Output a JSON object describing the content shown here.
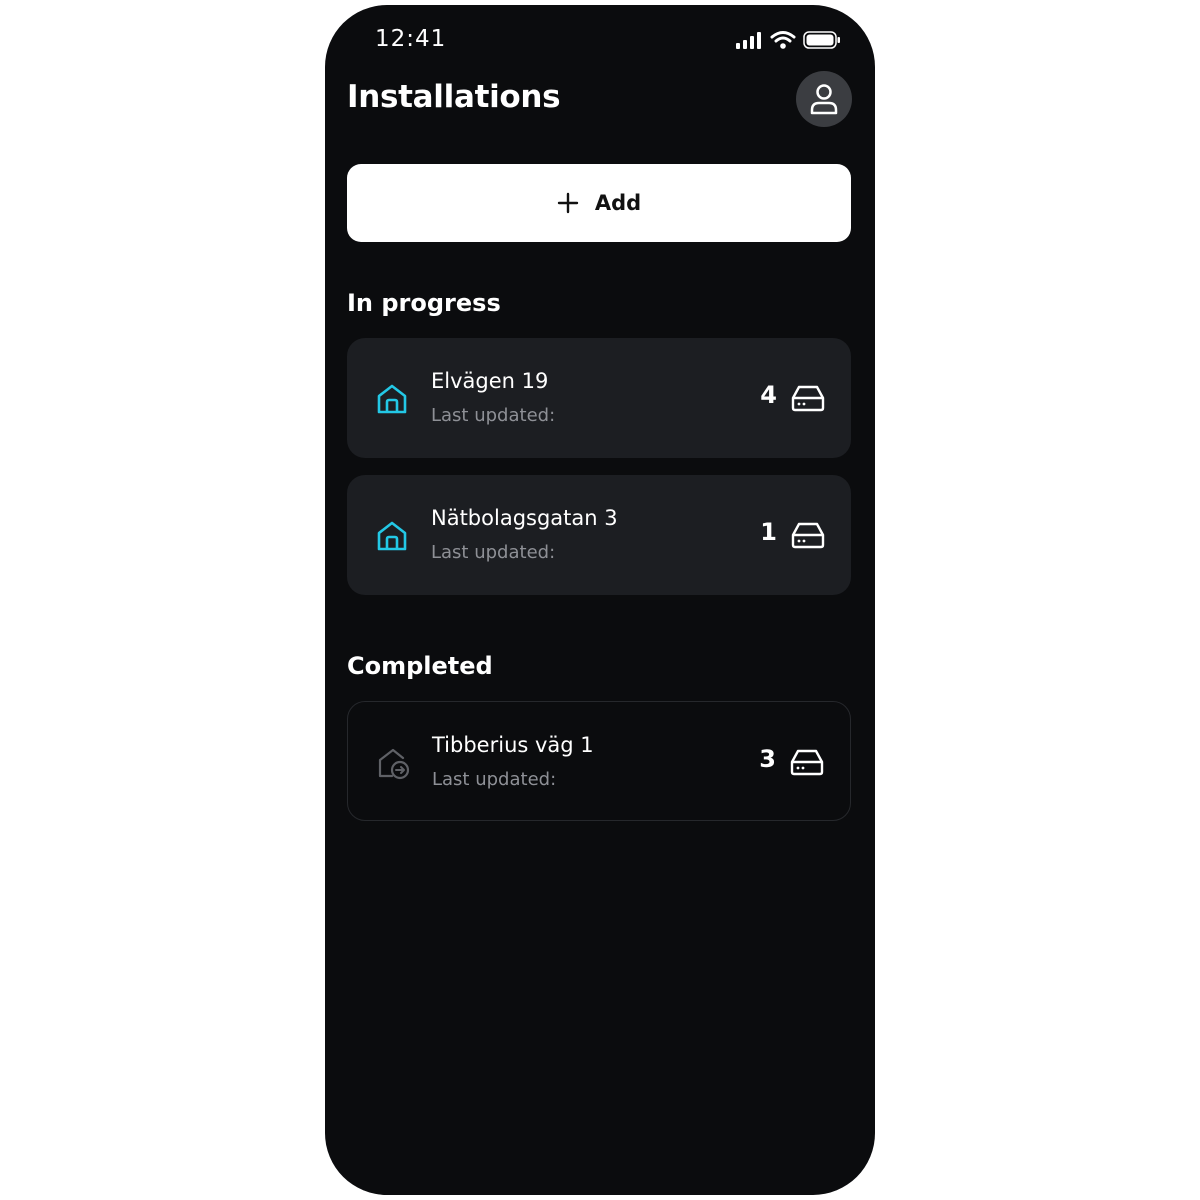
{
  "status_bar": {
    "time": "12:41"
  },
  "header": {
    "title": "Installations"
  },
  "add_button": {
    "label": "Add"
  },
  "sections": {
    "in_progress": {
      "heading": "In progress",
      "items": [
        {
          "name": "Elvägen 19",
          "subtitle": "Last updated:",
          "count": "4"
        },
        {
          "name": "Nätbolagsgatan 3",
          "subtitle": "Last updated:",
          "count": "1"
        }
      ]
    },
    "completed": {
      "heading": "Completed",
      "items": [
        {
          "name": "Tibberius väg 1",
          "subtitle": "Last updated:",
          "count": "3"
        }
      ]
    }
  },
  "colors": {
    "background": "#0b0c0e",
    "card": "#1c1e22",
    "accent": "#23c8e6",
    "muted": "#8e9096"
  },
  "icons": {
    "profile": "person-icon",
    "add": "plus-icon",
    "in_progress_item": "house-icon",
    "completed_item": "house-arrow-icon",
    "device": "device-icon"
  }
}
